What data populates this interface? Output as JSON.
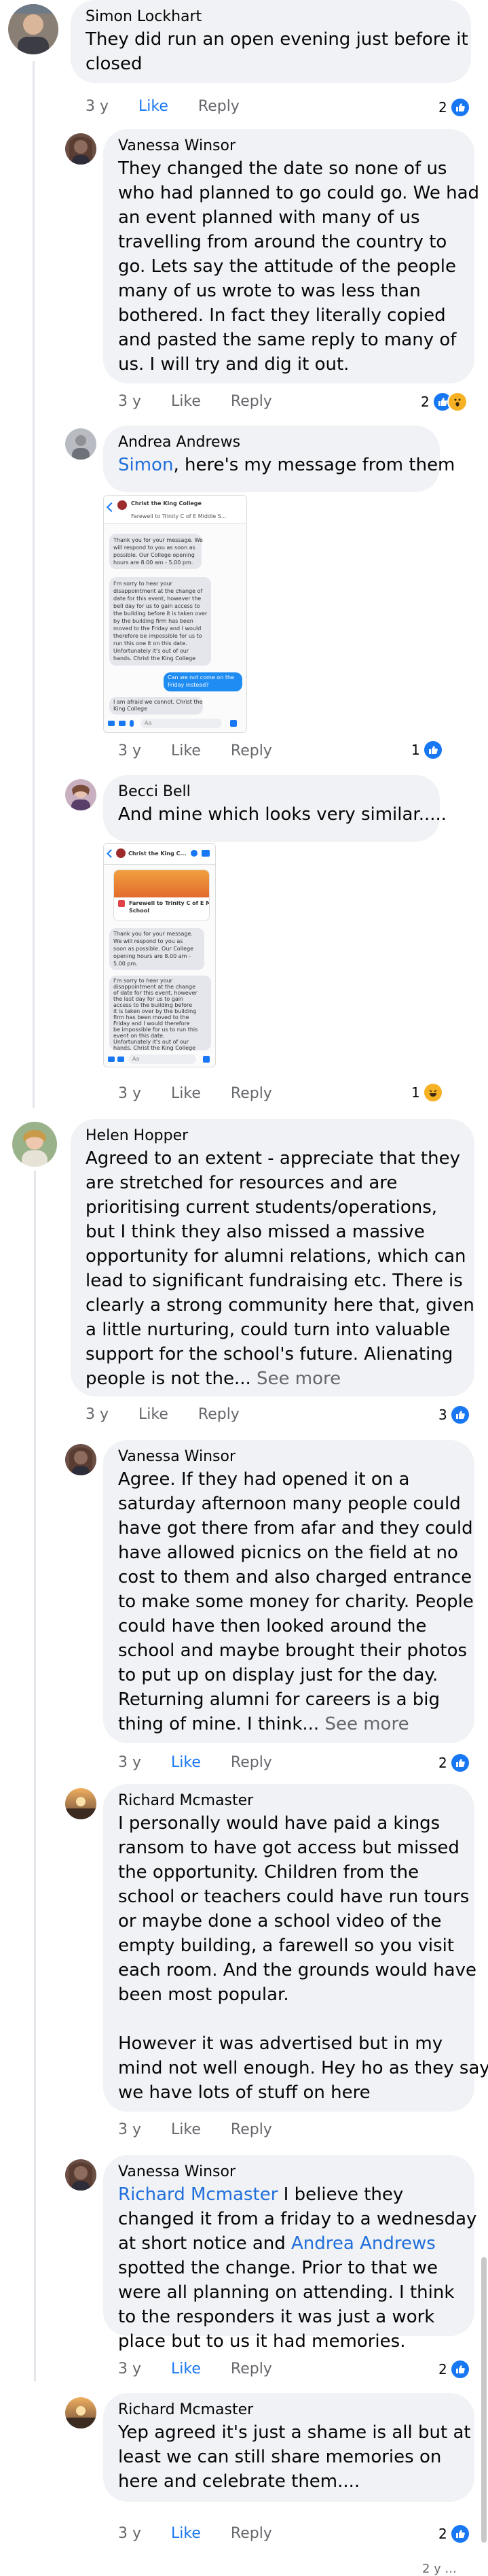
{
  "comments": [
    {
      "name": "Simon Lockhart",
      "lines": [
        "They did run an open evening just before it",
        "closed"
      ],
      "time": "3 y",
      "like_label": "Like",
      "reply_label": "Reply",
      "reaction_count": "2"
    },
    {
      "name": "Vanessa Winsor",
      "lines": [
        "They changed the date so none of us",
        "who had planned to go could go. We had",
        "an event planned with many of us",
        "travelling from around the country to",
        "go. Lets say the attitude of the people",
        "many of us wrote to was less than",
        "bothered. In fact they literally copied",
        "and pasted the same reply to many of",
        "us. I will try and dig it out."
      ],
      "time": "3 y",
      "like_label": "Like",
      "reply_label": "Reply",
      "reaction_count": "2"
    },
    {
      "name": "Andrea Andrews",
      "mention": "Simon",
      "text_after": ", here's my message from them",
      "time": "3 y",
      "like_label": "Like",
      "reply_label": "Reply",
      "reaction_count": "1"
    },
    {
      "name": "Becci Bell",
      "lines": [
        "And mine which looks very similar....."
      ],
      "time": "3 y",
      "like_label": "Like",
      "reply_label": "Reply",
      "reaction_count": "1"
    },
    {
      "name": "Helen Hopper",
      "lines": [
        "Agreed to an extent - appreciate that they",
        "are stretched for resources and are",
        "prioritising current students/operations,",
        "but I think they also missed a massive",
        "opportunity for alumni relations, which can",
        "lead to significant fundraising etc. There is",
        "clearly a strong community here that, given",
        "a little nurturing, could turn into valuable",
        "support for the school's future. Alienating"
      ],
      "last_line": "people is not the...",
      "see_more": "See more",
      "time": "3 y",
      "like_label": "Like",
      "reply_label": "Reply",
      "reaction_count": "3"
    },
    {
      "name": "Vanessa Winsor",
      "lines": [
        "Agree. If they had opened it on a",
        "saturday afternoon many people could",
        "have got there from afar and they could",
        "have allowed picnics on the field at no",
        "cost to them and also charged entrance",
        "to make some money for charity. People",
        "could have then looked around the",
        "school and maybe brought their photos",
        "to put up on display just for the day.",
        "Returning alumni for careers is a big"
      ],
      "last_line": "thing of mine. I think...",
      "see_more": "See more",
      "time": "3 y",
      "like_label": "Like",
      "reply_label": "Reply",
      "reaction_count": "2"
    },
    {
      "name": "Richard Mcmaster",
      "lines": [
        "I personally would have paid a kings",
        "ransom to have got access but missed",
        "the opportunity.  Children from the",
        "school or teachers could have run tours",
        "or maybe done a school video of the",
        "empty building, a farewell so you visit",
        "each room. And the grounds would have",
        "been most popular.",
        "",
        "However it was advertised but in my",
        "mind not well enough. Hey ho as they say",
        "we have lots of stuff on here"
      ],
      "time": "3 y",
      "like_label": "Like",
      "reply_label": "Reply"
    },
    {
      "name": "Vanessa Winsor",
      "mention1": "Richard Mcmaster",
      "line1_after": " I believe they",
      "line2": "changed it from a friday to a wednesday",
      "line3_before": "at short notice and ",
      "mention2": "Andrea Andrews",
      "lines_rest": [
        "spotted the change. Prior to that we",
        "were all planning on attending. I think",
        "to the responders it was just a work",
        "place but to us it had memories."
      ],
      "time": "3 y",
      "like_label": "Like",
      "reply_label": "Reply",
      "reaction_count": "2"
    },
    {
      "name": "Richard Mcmaster",
      "lines": [
        "Yep agreed it's  just a shame is all but at",
        "least we can still share memories on",
        "here and celebrate them...."
      ],
      "time": "3 y",
      "like_label": "Like",
      "reply_label": "Reply",
      "reaction_count": "2"
    }
  ],
  "screenshot1": {
    "title": "Christ the King College",
    "subtitle": "Farewell to Trinity C of E Middle S...",
    "msg1": [
      "Thank you for your message. We",
      "will respond to you as soon as",
      "possible. Our College opening",
      "hours are 8.00 am - 5.00 pm."
    ],
    "msg2": [
      "I'm sorry to hear your",
      "disappointment at the change of",
      "date for this event, however the",
      "bell day for us to gain access to",
      "the building before it is taken over",
      "by the building firm has been",
      "moved to the Friday and I would",
      "therefore be impossible for us to",
      "run this one it on this date.",
      "Unfortunately it's out of our",
      "hands. Christ the King College"
    ],
    "msg_me": [
      "Can we not come on the",
      "Friday instead?"
    ],
    "msg3": [
      "I am afraid we cannot. Christ the",
      "King College"
    ],
    "compose_placeholder": "Aa"
  },
  "screenshot2": {
    "title": "Christ the King C...",
    "card_title": [
      "Farewell to Trinity C of E Middle",
      "School"
    ],
    "msg1": [
      "Thank you for your message.",
      "We will respond to you as",
      "soon as possible. Our College",
      "opening hours are 8.00 am -",
      "5.00 pm."
    ],
    "msg2": [
      "I'm sorry to hear your",
      "disappointment at the change",
      "of date for this event, however",
      "the last day for us to gain",
      "access to the building before",
      "it is taken over by the building",
      "firm has been moved to the",
      "Friday and I would therefore",
      "be impossible for us to run this",
      "event on this date.",
      "Unfortunately it's out of our",
      "hands. Christ the King College"
    ],
    "compose_placeholder": "Aa"
  },
  "footer_partial": "2 y ..."
}
